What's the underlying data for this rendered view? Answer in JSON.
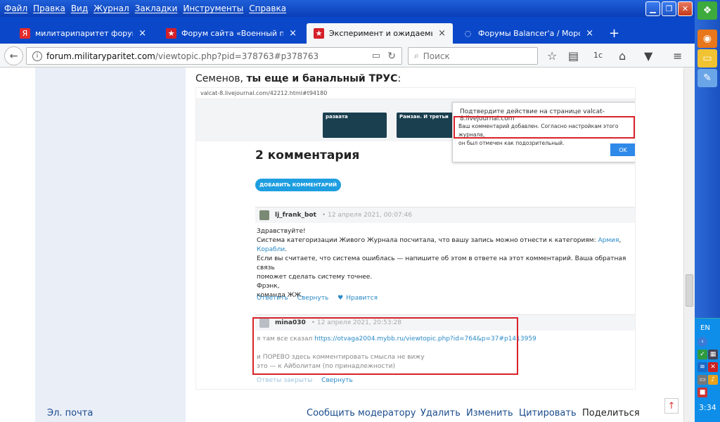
{
  "menu": [
    "Файл",
    "Правка",
    "Вид",
    "Журнал",
    "Закладки",
    "Инструменты",
    "Справка"
  ],
  "tabs": [
    {
      "label": "милитарипаритет форум — ...",
      "close": "×",
      "icon": "Я",
      "icon_color": "#e32c2c"
    },
    {
      "label": "Форум сайта «Военный пар...",
      "close": "×",
      "icon": "★",
      "icon_color": "#d4202a"
    },
    {
      "label": "Эксперимент и ожидаемые ...",
      "close": "×",
      "icon": "★",
      "icon_color": "#d4202a"
    },
    {
      "label": "Форумы Balancer'а / Морской",
      "close": "×",
      "icon": "◌",
      "icon_color": "#1b66e6"
    }
  ],
  "new_tab": "+",
  "url": {
    "host": "forum.militaryparitet.com",
    "path": "/viewtopic.php?pid=378763#p378763"
  },
  "search_placeholder": "Поиск",
  "post": {
    "heading_plain": "Семенов, ",
    "heading_bold": "ты еще и банальный ТРУС",
    "heading_end": ":"
  },
  "shot": {
    "addr": "valcat-8.livejournal.com/42212.html#t94180",
    "card1": "развата",
    "card2": "Рамзан. И третьи",
    "dialog_title": "Подтвердите действие на странице valcat-8.livejournal.com",
    "dialog_line1": "Ваш комментарий добавлен. Согласно настройкам этого журнала,",
    "dialog_line2": "он был отмечен как подозрительный.",
    "ok": "OK",
    "count": "2 комментария",
    "add_button": "ДОБАВИТЬ КОММЕНТАРИЙ",
    "c1": {
      "nick": "lj_frank_bot",
      "date": "• 12 апреля 2021, 00:07:46",
      "l1": "Здравствуйте!",
      "l2a": "Система категоризации Живого Журнала посчитала, что вашу запись можно отнести к категориям: ",
      "l2b": "Армия",
      "l2c": ",",
      "l3": "Корабли",
      "l3b": ".",
      "l4": "Если вы считаете, что система ошиблась — напишите об этом в ответе на этот комментарий. Ваша обратная связь",
      "l5": "поможет сделать систему точнее.",
      "l6": "Фрэнк,",
      "l7": "команда ЖЖ.",
      "a1": "Ответить",
      "a2": "Свернуть",
      "a3": "Нравится"
    },
    "c2": {
      "nick": "mina030",
      "date": "• 12 апреля 2021, 20:53:28",
      "l1a": "я там все сказал ",
      "l1b": "https://otvaga2004.mybb.ru/viewtopic.php?id=764&p=37#p1413959",
      "l2": "и ПОРЕВО здесь комментировать смысла не вижу",
      "l3": "это — к Айболитам (по принадлежности)",
      "a1": "Ответы закрыты",
      "a2": "Свернуть"
    }
  },
  "footer": {
    "email": "Эл. почта",
    "report": "Сообщить модератору",
    "delete": "Удалить",
    "edit": "Изменить",
    "quote": "Цитировать",
    "share": "Поделиться"
  },
  "tray": {
    "lang": "EN",
    "time": "3:34"
  }
}
